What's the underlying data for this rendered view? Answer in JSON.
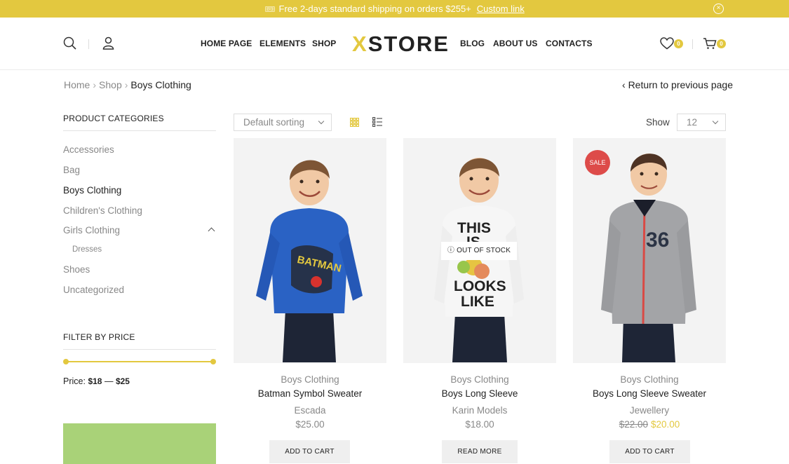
{
  "topbar": {
    "message": "Free 2-days standard shipping on orders $255+",
    "link": "Custom link",
    "ticket_icon": "🎟",
    "close_icon": "×"
  },
  "header": {
    "nav_left": [
      "HOME PAGE",
      "ELEMENTS",
      "SHOP"
    ],
    "logo_x": "X",
    "logo_rest": "STORE",
    "nav_right": [
      "BLOG",
      "ABOUT US",
      "CONTACTS"
    ],
    "wishlist_count": "0",
    "cart_count": "0"
  },
  "breadcrumb": {
    "items": [
      "Home",
      "Shop",
      "Boys Clothing"
    ],
    "separator": "›",
    "back_chevron": "‹",
    "back_label": "Return to previous page"
  },
  "sidebar": {
    "categories_title": "PRODUCT CATEGORIES",
    "categories": [
      "Accessories",
      "Bag",
      "Boys Clothing",
      "Children's Clothing",
      "Girls Clothing",
      "Dresses",
      "Shoes",
      "Uncategorized"
    ],
    "active_category": "Boys Clothing",
    "price_title": "FILTER BY PRICE",
    "price_prefix": "Price:",
    "price_min": "$18",
    "price_dash": "—",
    "price_max": "$25"
  },
  "toolbar": {
    "sorting": "Default sorting",
    "show_label": "Show",
    "show_value": "12"
  },
  "products": [
    {
      "category": "Boys Clothing",
      "name": "Batman Symbol Sweater",
      "brand": "Escada",
      "price": "$25.00",
      "button": "ADD TO CART",
      "shirt_color": "#2a62c4"
    },
    {
      "category": "Boys Clothing",
      "name": "Boys Long Sleeve",
      "brand": "Karin Models",
      "price": "$18.00",
      "button": "READ MORE",
      "badge": "OUT OF STOCK",
      "badge_icon": "ⓘ",
      "shirt_color": "#f4f4f4",
      "shirt_text": [
        "THIS",
        "IS",
        "LOOKS",
        "LIKE"
      ]
    },
    {
      "category": "Boys Clothing",
      "name": "Boys Long Sleeve Sweater",
      "brand": "Jewellery",
      "old_price": "$22.00",
      "price": "$20.00",
      "button": "ADD TO CART",
      "badge": "SALE",
      "shirt_color": "#a3a4a7",
      "shirt_text": [
        "36"
      ]
    }
  ],
  "colors": {
    "accent": "#e3c83f",
    "sale": "#dd4b49",
    "banner": "#a9d278"
  }
}
